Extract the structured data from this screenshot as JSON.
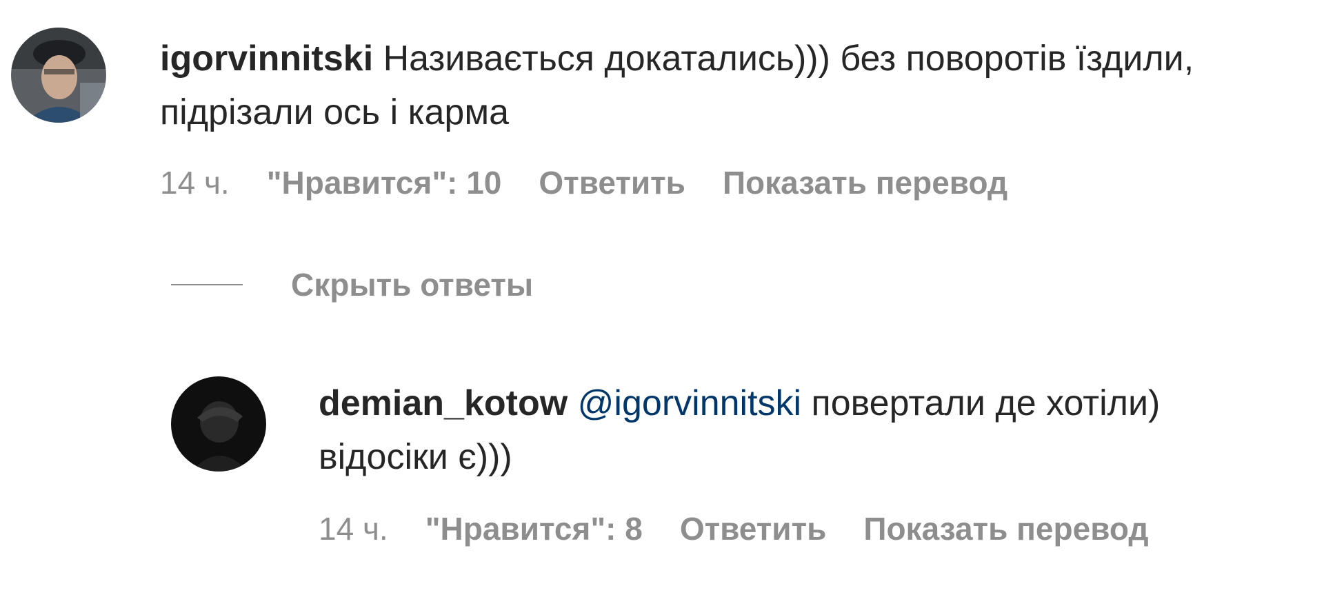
{
  "comment": {
    "username": "igorvinnitski",
    "text": "Називається докатались))) без поворотів їздили, підрізали ось і карма",
    "time": "14 ч.",
    "likes": "\"Нравится\": 10",
    "reply_label": "Ответить",
    "translate_label": "Показать перевод"
  },
  "hide_replies_label": "Скрыть ответы",
  "reply": {
    "username": "demian_kotow",
    "mention": "@igorvinnitski",
    "text": "повертали де хотіли) відосіки є)))",
    "time": "14 ч.",
    "likes": "\"Нравится\": 8",
    "reply_label": "Ответить",
    "translate_label": "Показать перевод"
  },
  "colors": {
    "text": "#262626",
    "muted": "#8e8e8e",
    "mention": "#00376b",
    "background": "#ffffff"
  }
}
